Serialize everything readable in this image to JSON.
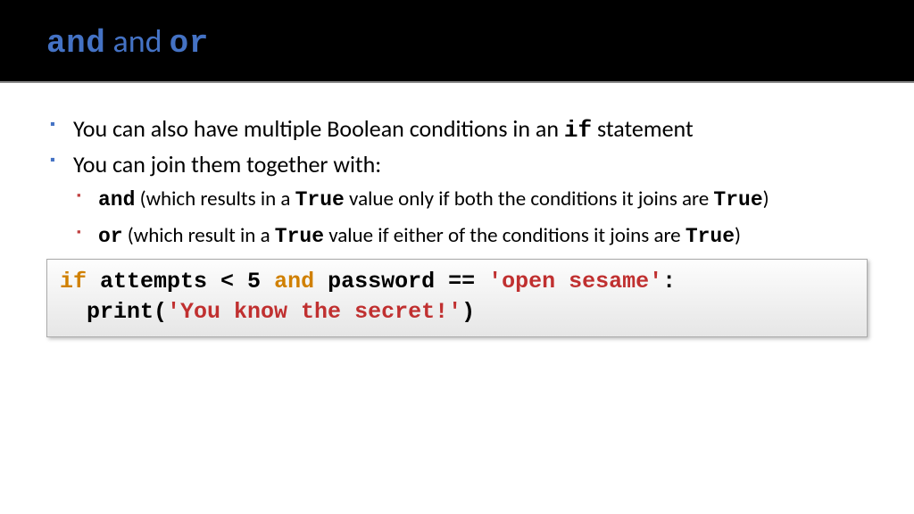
{
  "title": {
    "mono1": "and",
    "plain": " and ",
    "mono2": "or"
  },
  "bullets": {
    "b1": {
      "pre": "You can also have multiple Boolean conditions in an ",
      "code": "if",
      "post": " statement"
    },
    "b2": "You can join them together with:",
    "s1": {
      "kw": "and",
      "mid1": " (which results in a ",
      "true1": "True",
      "mid2": " value only if both the conditions it joins are ",
      "true2": "True",
      "end": ")"
    },
    "s2": {
      "kw": "or",
      "mid1": " (which result in a ",
      "true1": "True",
      "mid2": " value if either of the conditions it joins are ",
      "true2": "True",
      "end": ")"
    }
  },
  "code": {
    "l1": {
      "if": "if",
      "seg1": " attempts < 5 ",
      "and": "and",
      "seg2": " password == ",
      "str": "'open sesame'",
      "colon": ":"
    },
    "l2": {
      "indent": "  print(",
      "str": "'You know the secret!'",
      "close": ")"
    }
  }
}
